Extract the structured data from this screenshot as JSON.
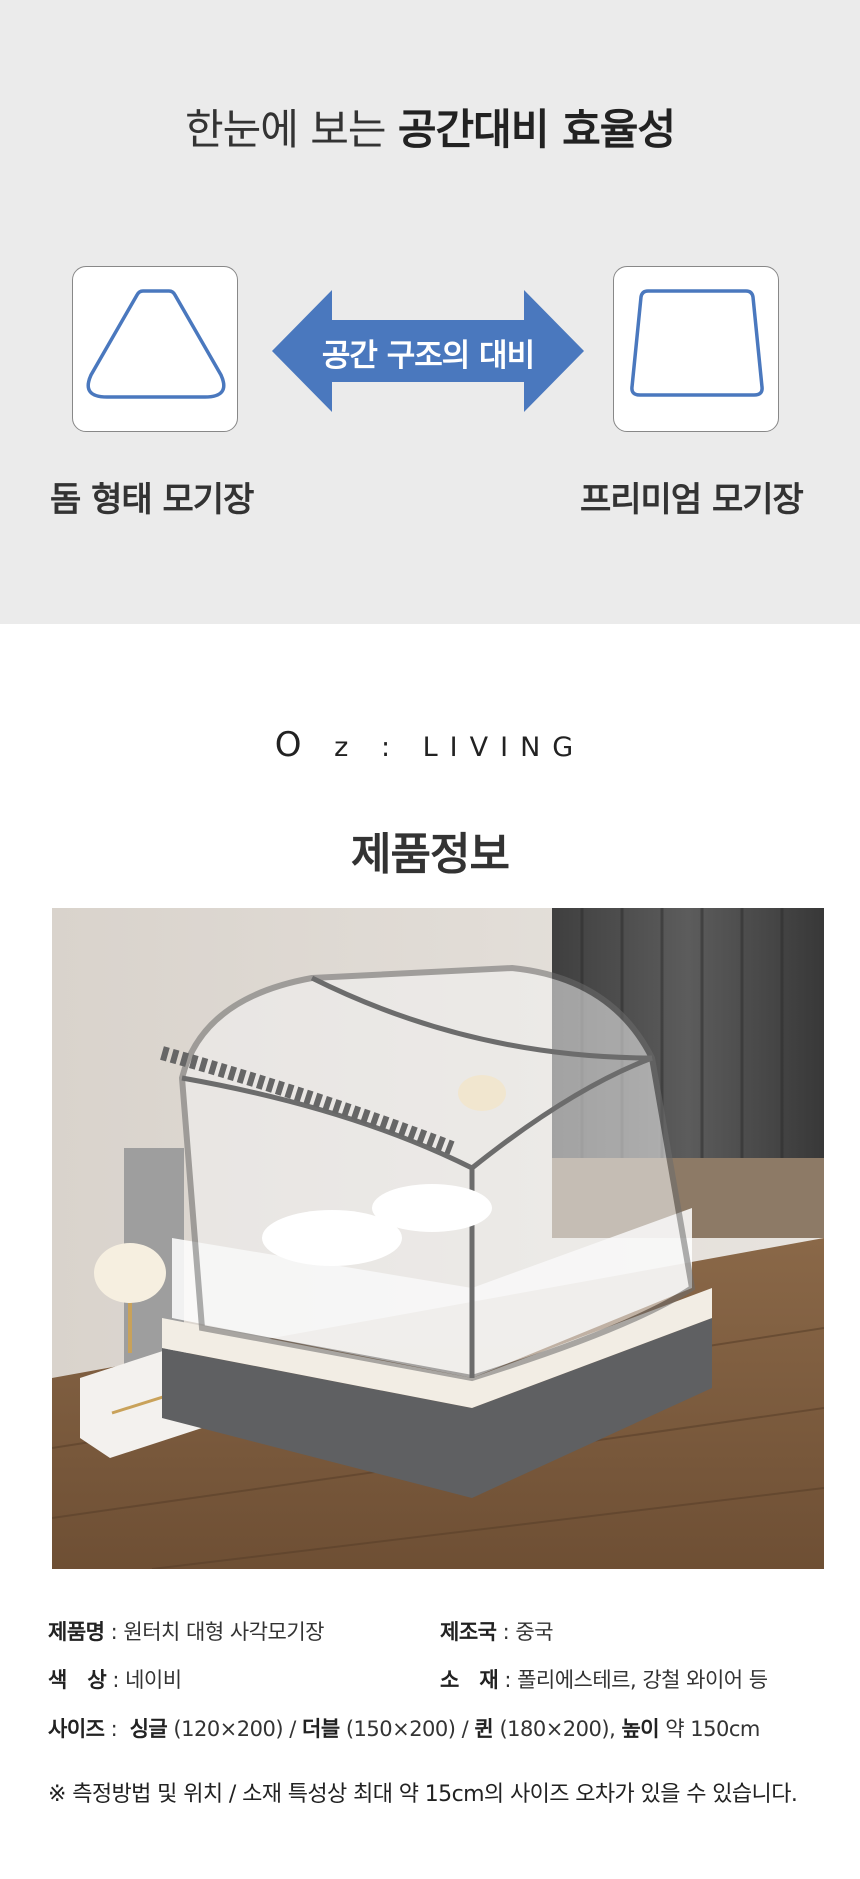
{
  "comparison": {
    "headline_light": "한눈에 보는",
    "headline_bold": "공간대비 효율성",
    "arrow_label": "공간 구조의 대비",
    "left_caption": "돔 형태 모기장",
    "right_caption": "프리미엄 모기장",
    "accent_color": "#4a78be"
  },
  "brand": {
    "o": "O",
    "z": "z",
    "colon": ":",
    "living": "LIVING"
  },
  "product": {
    "section_title": "제품정보",
    "specs": {
      "name_label": "제품명",
      "name_value": "원터치 대형 사각모기장",
      "country_label": "제조국",
      "country_value": "중국",
      "color_label": "색　상",
      "color_value": "네이비",
      "material_label": "소　재",
      "material_value": "폴리에스테르, 강철 와이어 등",
      "size_label": "사이즈",
      "single_label": "싱글",
      "single_value": "(120×200) /",
      "double_label": "더블",
      "double_value": "(150×200) /",
      "queen_label": "퀸",
      "queen_value": "(180×200),",
      "height_label": "높이",
      "height_value": "약 150cm"
    },
    "note": "※ 측정방법 및 위치 / 소재 특성상 최대 약 15cm의 사이즈 오차가 있을 수 있습니다."
  }
}
